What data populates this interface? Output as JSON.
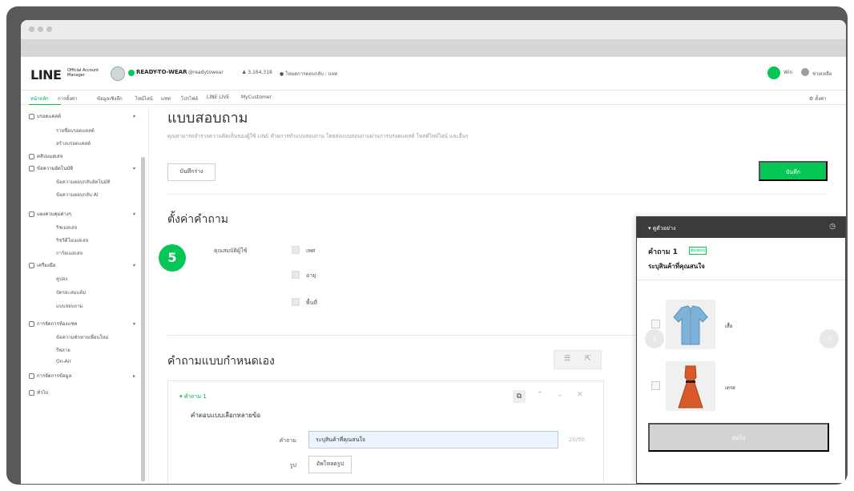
{
  "header": {
    "logo": "LINE",
    "logo_sub": "Official Account Manager",
    "account_name": "READY-TO-WEAR",
    "account_id": "@readytowear",
    "followers": "3,164,318",
    "reply_status": "โหมดการตอบกลับ : บอท",
    "user_name": "Win",
    "help": "ช่วยเหลือ"
  },
  "nav": {
    "items": [
      "หน้าหลัก",
      "การตั้งค่า",
      "ข้อมูลเชิงลึก",
      "ไทม์ไลน์",
      "แชท",
      "โปรไฟล์",
      "LINE LIVE",
      "MyCustomer"
    ],
    "settings": "ตั้งค่า"
  },
  "sidebar": {
    "items": [
      {
        "label": "บรอดแคสต์",
        "type": "section"
      },
      {
        "label": "รายชื่อบรอดแคสต์",
        "type": "sub"
      },
      {
        "label": "สร้างบรอดแคสต์",
        "type": "sub"
      },
      {
        "label": "คลิปแมสเสจ",
        "type": "section"
      },
      {
        "label": "ข้อความอัตโนมัติ",
        "type": "section"
      },
      {
        "label": "ข้อความตอบกลับอัตโนมัติ",
        "type": "sub"
      },
      {
        "label": "ข้อความตอบกลับ AI",
        "type": "sub"
      },
      {
        "label": "แผงควบคุมต่างๆ",
        "type": "section"
      },
      {
        "label": "ริชเมสเสจ",
        "type": "sub"
      },
      {
        "label": "ริชวิดีโอเมสเสจ",
        "type": "sub"
      },
      {
        "label": "การ์ดเมสเสจ",
        "type": "sub"
      },
      {
        "label": "เครื่องมือ",
        "type": "section"
      },
      {
        "label": "คูปอง",
        "type": "sub"
      },
      {
        "label": "บัตรสะสมแต้ม",
        "type": "sub"
      },
      {
        "label": "แบบสอบถาม",
        "type": "sub"
      },
      {
        "label": "การจัดการห้องแชท",
        "type": "section"
      },
      {
        "label": "ข้อความทักทายเพื่อนใหม่",
        "type": "sub"
      },
      {
        "label": "รีพลาย",
        "type": "sub"
      },
      {
        "label": "On-Air",
        "type": "sub"
      },
      {
        "label": "การจัดการข้อมูล",
        "type": "section"
      },
      {
        "label": "ทั่วไป",
        "type": "section"
      }
    ]
  },
  "main": {
    "title": "แบบสอบถาม",
    "description": "คุณสามารถสำรวจความคิดเห็นของผู้ใช้ LINE ด้วยการทำแบบสอบถาม โดยส่งแบบสอบถามผ่านการบรอดแคสต์ โพสต์ไทม์ไลน์ และอื่นๆ",
    "draft_button": "บันทึกร่าง",
    "save_button": "บันทึก",
    "settings_title": "ตั้งค่าคำถาม",
    "attr_label": "คุณสมบัติผู้ใช้",
    "attributes": [
      "เพศ",
      "อายุ",
      "พื้นที่"
    ],
    "step_badge": "5",
    "custom_title": "คำถามแบบกำหนดเอง",
    "question": {
      "name": "คำถาม 1",
      "type": "คำตอบแบบเลือกหลายข้อ",
      "field_label": "คำถาม",
      "field_value": "ระบุสินค้าที่คุณสนใจ",
      "counter": "20/50",
      "image_label": "รูป",
      "upload_button": "อัพโหลดรูป"
    }
  },
  "preview": {
    "title": "ดูตัวอย่าง",
    "question_label": "คำถาม 1",
    "required_badge": "ต้องตอบ",
    "question_text": "ระบุสินค้าที่คุณสนใจ",
    "options": [
      "เสื้อ",
      "เดรส"
    ],
    "next_button": "ต่อไป"
  }
}
